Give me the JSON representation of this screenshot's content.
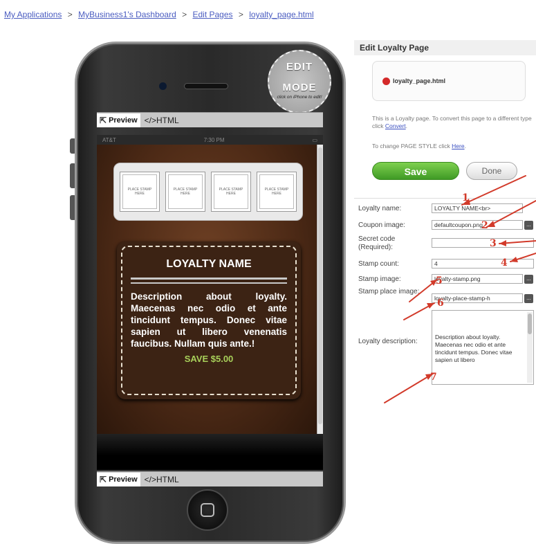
{
  "breadcrumb": {
    "items": [
      "My Applications",
      "MyBusiness1's Dashboard",
      "Edit Pages",
      "loyalty_page.html"
    ],
    "separator": ">"
  },
  "badge": {
    "line1": "EDIT",
    "line2": "MODE",
    "hint": "click on iPhone to edit!"
  },
  "tabs": {
    "preview": "Preview",
    "html": "</>HTML"
  },
  "phone": {
    "carrier": "AT&T",
    "time": "7:30 PM",
    "stamp_text": "PLACE STAMP HERE",
    "stamp_count": 4,
    "loyalty_name": "LOYALTY NAME",
    "description": "Description about loyalty. Maecenas nec odio et ante tincidunt tempus. Donec vitae sapien ut libero venenatis faucibus. Nullam quis ante.!",
    "save_text": "SAVE $5.00"
  },
  "panel": {
    "title": "Edit Loyalty Page",
    "file_name": "loyalty_page.html",
    "info1_text": "This is a Loyalty page. To convert this page to a different type click",
    "info1_link": "Convert",
    "info2_text": "To change PAGE STYLE click",
    "info2_link": "Here",
    "save_label": "Save",
    "done_label": "Done"
  },
  "form": {
    "loyalty_name_label": "Loyalty name:",
    "loyalty_name_value": "LOYALTY NAME<br>",
    "coupon_image_label": "Coupon image:",
    "coupon_image_value": "defaultcoupon.png",
    "secret_code_label": "Secret code (Required):",
    "secret_code_value": "",
    "stamp_count_label": "Stamp count:",
    "stamp_count_value": "4",
    "stamp_image_label": "Stamp image:",
    "stamp_image_value": "loyalty-stamp.png",
    "stamp_place_label": "Stamp place image:",
    "stamp_place_value": "loyalty-place-stamp-h",
    "description_label": "Loyalty description:",
    "description_value": "Description about loyalty. Maecenas nec odio et ante tincidunt tempus. Donec vitae sapien ut libero",
    "browse_label": "..."
  },
  "annotations": [
    "1",
    "2",
    "3",
    "4",
    "5",
    "6",
    "7"
  ],
  "colors": {
    "link": "#4a5cc0",
    "save_green": "#4fb030",
    "annotation_red": "#d23a2a",
    "leather": "#5a3219",
    "save_text": "#a8d05a"
  }
}
